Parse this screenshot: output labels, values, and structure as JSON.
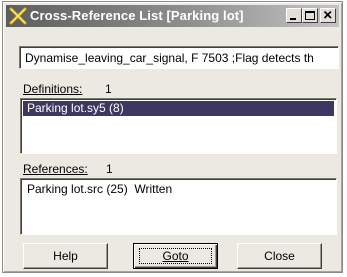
{
  "window": {
    "title": "Cross-Reference List [Parking lot]",
    "icons": {
      "app": "x-crossref-icon",
      "minimize": "minimize-icon",
      "maximize": "maximize-icon",
      "close": "close-icon"
    }
  },
  "info": {
    "text": "Dynamise_leaving_car_signal, F 7503 ;Flag detects th"
  },
  "definitions": {
    "label": "Definitions:",
    "count": "1",
    "items": [
      {
        "text": "Parking lot.sy5 (8)",
        "selected": true
      }
    ]
  },
  "references": {
    "label": "References:",
    "count": "1",
    "items": [
      {
        "text": "Parking lot.src (25)  Written",
        "selected": false
      }
    ]
  },
  "buttons": {
    "help": "Help",
    "goto": "Goto",
    "close": "Close"
  },
  "colors": {
    "selection": "#3d3761",
    "titlebar_start": "#5d5d5d",
    "titlebar_end": "#c4c4c4",
    "face": "#ece9e2"
  }
}
